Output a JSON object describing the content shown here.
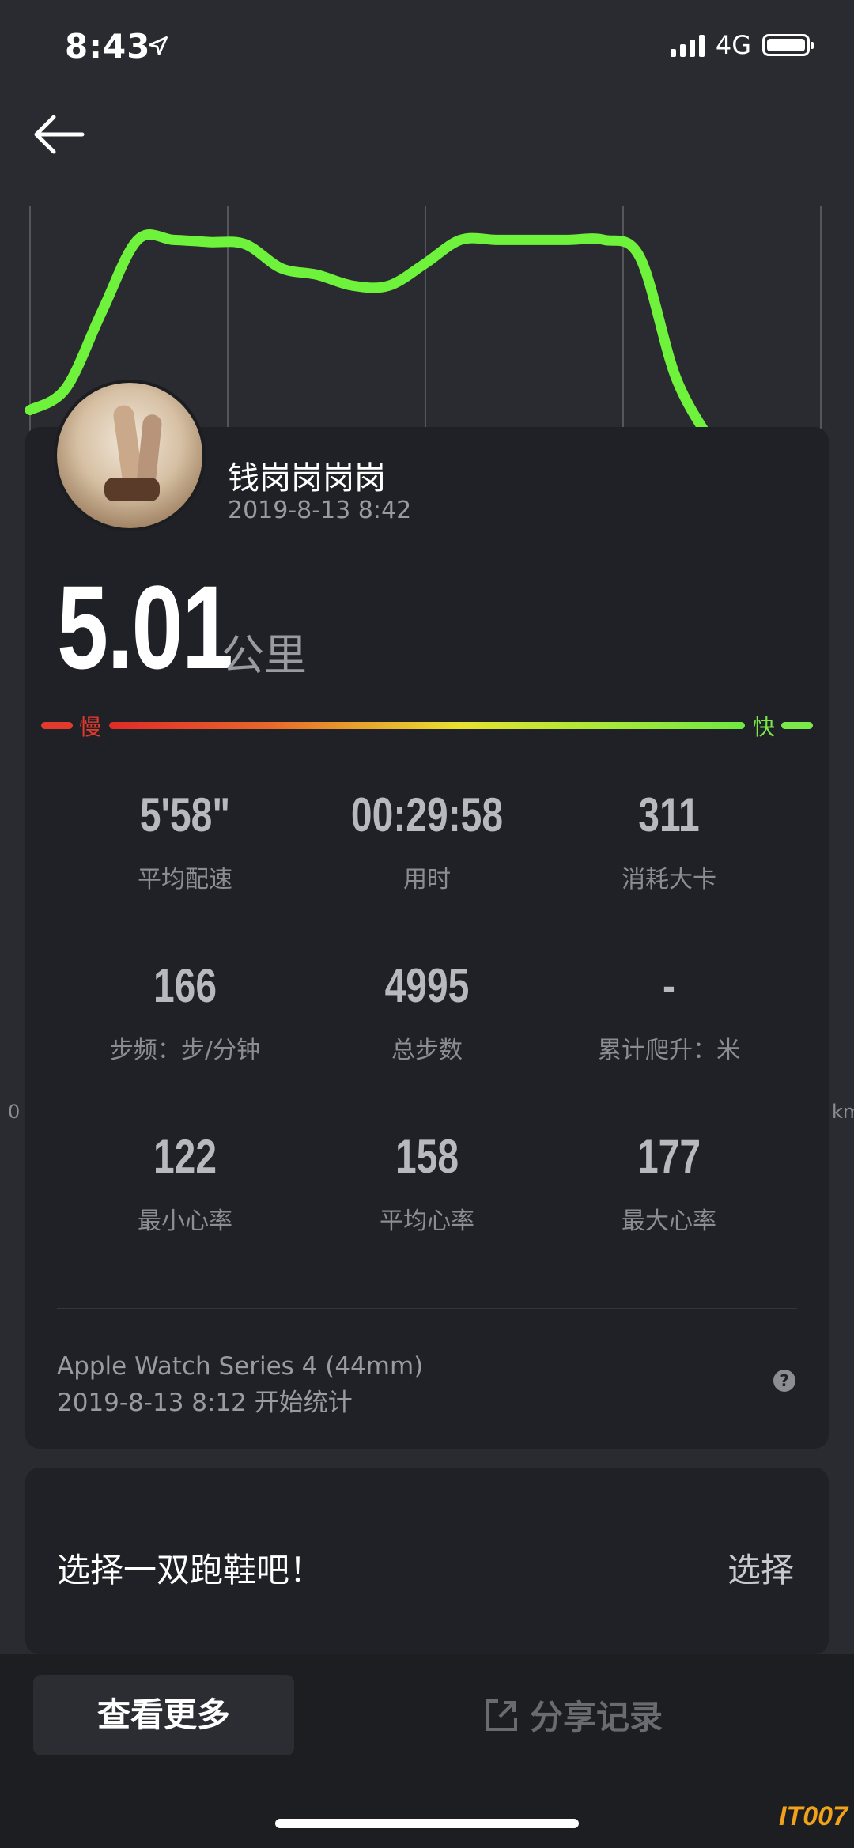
{
  "status_bar": {
    "time": "8:43",
    "network": "4G",
    "battery_level": 1.0
  },
  "chart_data": {
    "type": "line",
    "series": [
      {
        "values": [
          0.15,
          0.25,
          0.6,
          0.93,
          0.93,
          0.92,
          0.91,
          0.8,
          0.77,
          0.72,
          0.72,
          0.82,
          0.93,
          0.93,
          0.93,
          0.93,
          0.93,
          0.85,
          0.3,
          0.0
        ]
      }
    ],
    "color": "#6ef23c",
    "grid": true
  },
  "side_labels": {
    "left": "0",
    "right": "km"
  },
  "profile": {
    "name": "钱岗岗岗岗",
    "datetime": "2019-8-13 8:42"
  },
  "summary": {
    "distance": "5.01",
    "unit": "公里"
  },
  "speed_bar": {
    "slow_label": "慢",
    "fast_label": "快"
  },
  "stats": [
    {
      "value": "5'58\"",
      "label": "平均配速"
    },
    {
      "value": "00:29:58",
      "label": "用时"
    },
    {
      "value": "311",
      "label": "消耗大卡"
    },
    {
      "value": "166",
      "label": "步频：步/分钟"
    },
    {
      "value": "4995",
      "label": "总步数"
    },
    {
      "value": "-",
      "label": "累计爬升：米"
    },
    {
      "value": "122",
      "label": "最小心率"
    },
    {
      "value": "158",
      "label": "平均心率"
    },
    {
      "value": "177",
      "label": "最大心率"
    }
  ],
  "device": {
    "name": "Apple Watch Series 4 (44mm)",
    "start": "2019-8-13 8:12 开始统计",
    "help_icon": "?"
  },
  "shoe": {
    "prompt": "选择一双跑鞋吧！",
    "select_label": "选择"
  },
  "bottom": {
    "more_label": "查看更多",
    "share_label": "分享记录"
  },
  "watermark": "IT007",
  "colors": {
    "background": "#2a2b30",
    "card": "#202126",
    "accent": "#6ef23c",
    "slow": "#e23a2c"
  }
}
